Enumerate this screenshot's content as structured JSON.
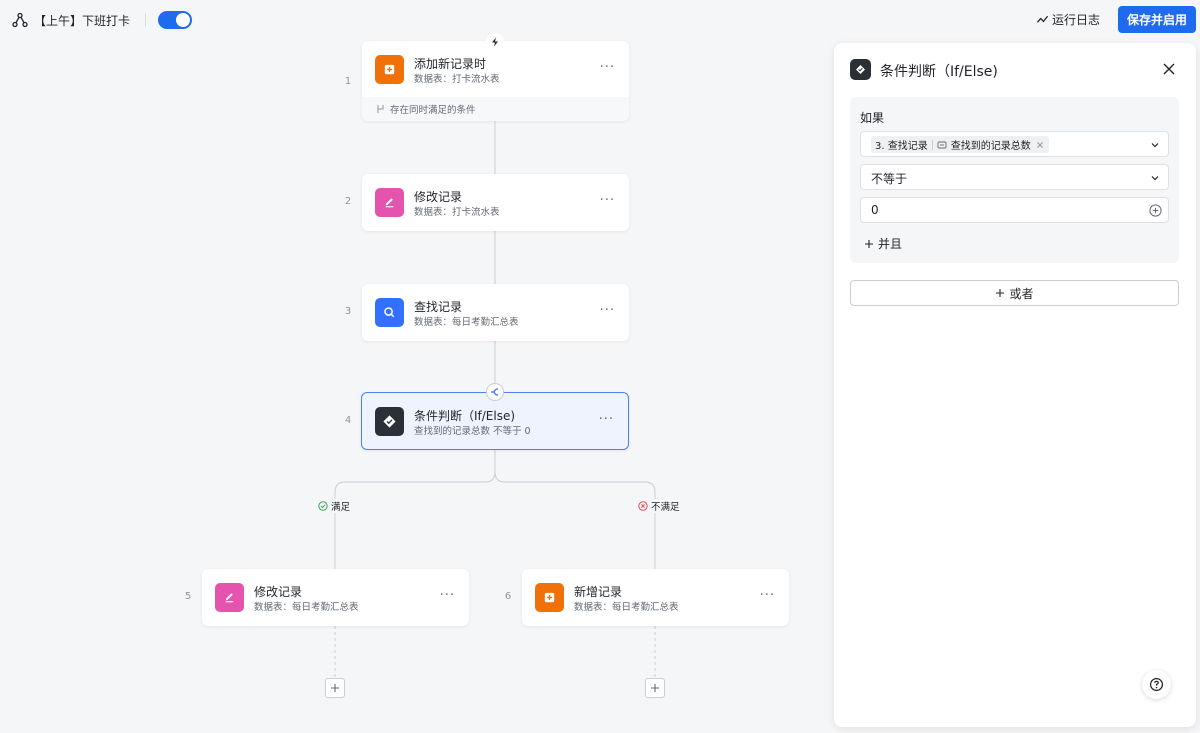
{
  "header": {
    "workflow_title": "【上午】下班打卡",
    "enabled": true,
    "run_log_label": "运行日志",
    "save_label": "保存并启用"
  },
  "colors": {
    "primary": "#1e6bf0",
    "orange": "#f0700a",
    "pink": "#e453ad",
    "blue": "#3370ff",
    "dark": "#2b2f36",
    "success": "#34a853",
    "danger": "#e34d59"
  },
  "nodes": [
    {
      "num": "1",
      "title": "添加新记录时",
      "subtitle": "数据表：打卡流水表",
      "icon": "add-record-icon",
      "footer": "存在同时满足的条件"
    },
    {
      "num": "2",
      "title": "修改记录",
      "subtitle": "数据表：打卡流水表",
      "icon": "edit-icon"
    },
    {
      "num": "3",
      "title": "查找记录",
      "subtitle": "数据表：每日考勤汇总表",
      "icon": "search-icon"
    },
    {
      "num": "4",
      "title": "条件判断（If/Else)",
      "subtitle": "查找到的记录总数 不等于 0",
      "icon": "condition-icon"
    },
    {
      "num": "5",
      "title": "修改记录",
      "subtitle": "数据表：每日考勤汇总表",
      "icon": "edit-icon"
    },
    {
      "num": "6",
      "title": "新增记录",
      "subtitle": "数据表：每日考勤汇总表",
      "icon": "add-record-icon"
    }
  ],
  "node_more": "···",
  "branches": {
    "yes_label": "满足",
    "no_label": "不满足"
  },
  "panel": {
    "title": "条件判断（If/Else)",
    "if_label": "如果",
    "field_tag_step": "3. 查找记录",
    "field_tag_value": "查找到的记录总数",
    "operator": "不等于",
    "value": "0",
    "and_label": "并且",
    "or_label": "或者"
  }
}
